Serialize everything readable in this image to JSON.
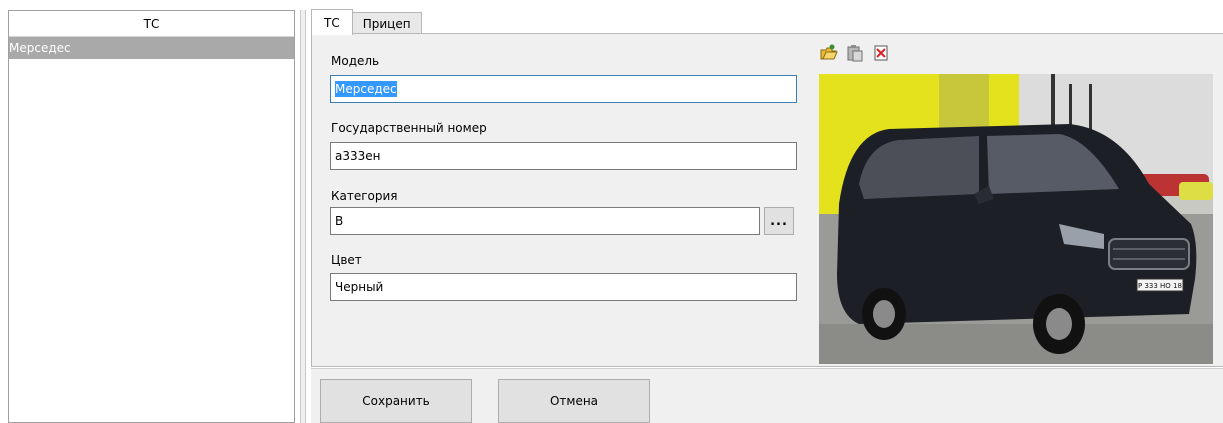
{
  "list": {
    "header": "ТС",
    "rows": [
      "Мерседес"
    ]
  },
  "tabs": [
    {
      "label": "ТС",
      "active": true
    },
    {
      "label": "Прицеп",
      "active": false
    }
  ],
  "form": {
    "model_label": "Модель",
    "model_value": "Мерседес",
    "plate_label": "Государственный номер",
    "plate_value": "а333ен",
    "category_label": "Категория",
    "category_value": "B",
    "category_browse": "...",
    "color_label": "Цвет",
    "color_value": "Черный"
  },
  "image_toolbar": {
    "icons": [
      "open-image-icon",
      "paste-image-icon",
      "delete-image-icon"
    ]
  },
  "photo": {
    "plate_text": "Р 333 НО 18"
  },
  "buttons": {
    "save": "Сохранить",
    "cancel": "Отмена"
  },
  "colors": {
    "selection": "#3399ff",
    "list_selected": "#a9a9a9",
    "panel_bg": "#f0f0f0"
  }
}
